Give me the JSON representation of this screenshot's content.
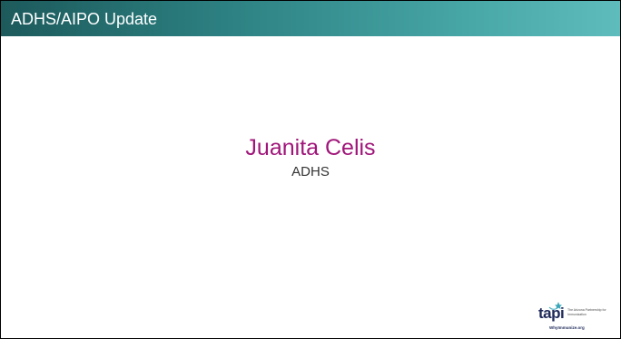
{
  "header": {
    "title": "ADHS/AIPO Update"
  },
  "presenter": {
    "name": "Juanita Celis",
    "organization": "ADHS"
  },
  "logo": {
    "wordmark": "tapi",
    "tagline": "The Arizona Partnership for Immunization",
    "url": "WhyImmunize.org"
  },
  "colors": {
    "header_dark": "#1d5a5c",
    "header_light": "#5fbcbc",
    "name_color": "#a0157a",
    "logo_navy": "#1f2a5a",
    "logo_star": "#3aa6b8"
  }
}
